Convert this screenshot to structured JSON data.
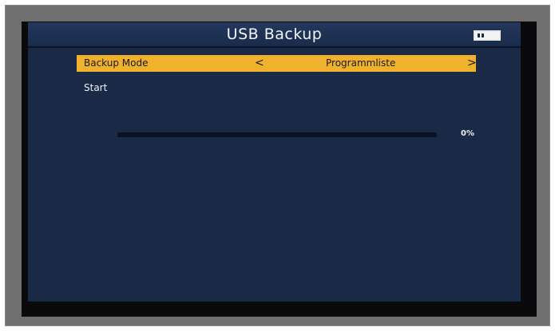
{
  "header": {
    "title": "USB Backup",
    "battery_icon": "battery-icon"
  },
  "menu": {
    "items": [
      {
        "label": "Backup Mode",
        "value": "Programmliste",
        "left_arrow": "<",
        "right_arrow": ">",
        "selected": true
      },
      {
        "label": "Start"
      }
    ]
  },
  "progress": {
    "value": 0,
    "label": "0%"
  },
  "colors": {
    "accent": "#f0b12c",
    "background": "#1a2a46",
    "bezel": "#6f6f6f"
  }
}
